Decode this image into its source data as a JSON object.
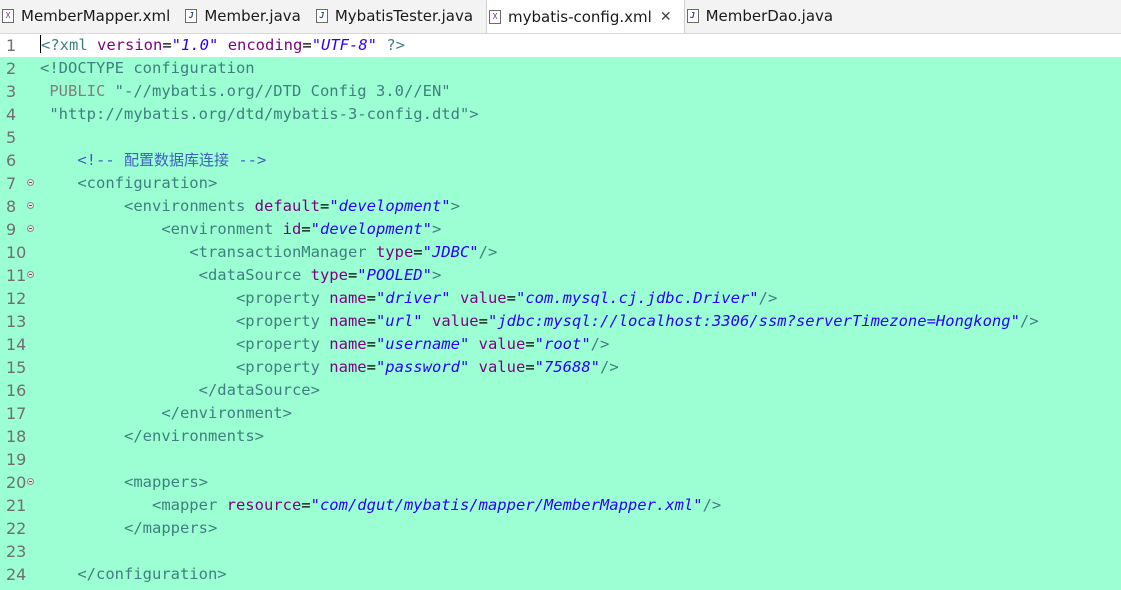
{
  "tabs": [
    {
      "label": "MemberMapper.xml",
      "icon": "xml-file-icon",
      "glyph": "X",
      "kind": "xml",
      "active": false,
      "closable": false
    },
    {
      "label": "Member.java",
      "icon": "java-file-icon",
      "glyph": "J",
      "kind": "java",
      "active": false,
      "closable": false
    },
    {
      "label": "MybatisTester.java",
      "icon": "java-file-icon",
      "glyph": "J",
      "kind": "java",
      "active": false,
      "closable": false
    },
    {
      "label": "mybatis-config.xml",
      "icon": "xml-file-icon",
      "glyph": "X",
      "kind": "xml",
      "active": true,
      "closable": true
    },
    {
      "label": "MemberDao.java",
      "icon": "java-file-icon",
      "glyph": "J",
      "kind": "java",
      "active": false,
      "closable": false
    }
  ],
  "close_glyph": "✕",
  "editor": {
    "background": "#9cffd4",
    "current_line_background": "#ffffff",
    "lines": [
      {
        "n": "1",
        "fold": false,
        "current": true,
        "caret": true,
        "indent": "",
        "tokens": [
          {
            "t": "<?xml ",
            "c": "t-pi"
          },
          {
            "t": "version",
            "c": "t-attr"
          },
          {
            "t": "=",
            "c": "t-plain"
          },
          {
            "t": "\"1.0\"",
            "c": "t-str"
          },
          {
            "t": " ",
            "c": "t-plain"
          },
          {
            "t": "encoding",
            "c": "t-attr"
          },
          {
            "t": "=",
            "c": "t-plain"
          },
          {
            "t": "\"UTF-8\"",
            "c": "t-str"
          },
          {
            "t": " ?>",
            "c": "t-pi"
          }
        ]
      },
      {
        "n": "2",
        "fold": false,
        "indent": "",
        "tokens": [
          {
            "t": "<!DOCTYPE ",
            "c": "t-doc"
          },
          {
            "t": "configuration",
            "c": "t-doc"
          }
        ]
      },
      {
        "n": "3",
        "fold": false,
        "indent": " ",
        "tokens": [
          {
            "t": "PUBLIC ",
            "c": "t-pub"
          },
          {
            "t": "\"-//mybatis.org//DTD Config 3.0//EN\"",
            "c": "t-docstr"
          }
        ]
      },
      {
        "n": "4",
        "fold": false,
        "indent": " ",
        "tokens": [
          {
            "t": "\"http://mybatis.org/dtd/mybatis-3-config.dtd\"",
            "c": "t-docstr"
          },
          {
            "t": ">",
            "c": "t-doc"
          }
        ]
      },
      {
        "n": "5",
        "fold": false,
        "indent": "",
        "tokens": []
      },
      {
        "n": "6",
        "fold": false,
        "indent": "    ",
        "tokens": [
          {
            "t": "<!-- ",
            "c": "t-cmt"
          },
          {
            "t": "配置数据库连接",
            "c": "t-cmt t-cn"
          },
          {
            "t": " -->",
            "c": "t-cmt"
          }
        ]
      },
      {
        "n": "7",
        "fold": true,
        "indent": "    ",
        "tokens": [
          {
            "t": "<configuration>",
            "c": "t-tag"
          }
        ]
      },
      {
        "n": "8",
        "fold": true,
        "indent": "         ",
        "tokens": [
          {
            "t": "<environments ",
            "c": "t-tag"
          },
          {
            "t": "default",
            "c": "t-attr"
          },
          {
            "t": "=",
            "c": "t-plain"
          },
          {
            "t": "\"development\"",
            "c": "t-str"
          },
          {
            "t": ">",
            "c": "t-tag"
          }
        ]
      },
      {
        "n": "9",
        "fold": true,
        "indent": "             ",
        "tokens": [
          {
            "t": "<environment ",
            "c": "t-tag"
          },
          {
            "t": "id",
            "c": "t-attr"
          },
          {
            "t": "=",
            "c": "t-plain"
          },
          {
            "t": "\"development\"",
            "c": "t-str"
          },
          {
            "t": ">",
            "c": "t-tag"
          }
        ]
      },
      {
        "n": "10",
        "fold": false,
        "indent": "                ",
        "tokens": [
          {
            "t": "<transactionManager ",
            "c": "t-tag"
          },
          {
            "t": "type",
            "c": "t-attr"
          },
          {
            "t": "=",
            "c": "t-plain"
          },
          {
            "t": "\"JDBC\"",
            "c": "t-str"
          },
          {
            "t": "/>",
            "c": "t-tag"
          }
        ]
      },
      {
        "n": "11",
        "fold": true,
        "indent": "                 ",
        "tokens": [
          {
            "t": "<dataSource ",
            "c": "t-tag"
          },
          {
            "t": "type",
            "c": "t-attr"
          },
          {
            "t": "=",
            "c": "t-plain"
          },
          {
            "t": "\"POOLED\"",
            "c": "t-str"
          },
          {
            "t": ">",
            "c": "t-tag"
          }
        ]
      },
      {
        "n": "12",
        "fold": false,
        "indent": "                     ",
        "tokens": [
          {
            "t": "<property ",
            "c": "t-tag"
          },
          {
            "t": "name",
            "c": "t-attr"
          },
          {
            "t": "=",
            "c": "t-plain"
          },
          {
            "t": "\"driver\"",
            "c": "t-str"
          },
          {
            "t": " ",
            "c": "t-plain"
          },
          {
            "t": "value",
            "c": "t-attr"
          },
          {
            "t": "=",
            "c": "t-plain"
          },
          {
            "t": "\"com.mysql.cj.jdbc.Driver\"",
            "c": "t-str"
          },
          {
            "t": "/>",
            "c": "t-tag"
          }
        ]
      },
      {
        "n": "13",
        "fold": false,
        "indent": "                     ",
        "tokens": [
          {
            "t": "<property ",
            "c": "t-tag"
          },
          {
            "t": "name",
            "c": "t-attr"
          },
          {
            "t": "=",
            "c": "t-plain"
          },
          {
            "t": "\"url\"",
            "c": "t-str"
          },
          {
            "t": " ",
            "c": "t-plain"
          },
          {
            "t": "value",
            "c": "t-attr"
          },
          {
            "t": "=",
            "c": "t-plain"
          },
          {
            "t": "\"jdbc:mysql://localhost:3306/ssm?serverTimezone=Hongkong\"",
            "c": "t-str"
          },
          {
            "t": "/>",
            "c": "t-tag"
          }
        ]
      },
      {
        "n": "14",
        "fold": false,
        "indent": "                     ",
        "tokens": [
          {
            "t": "<property ",
            "c": "t-tag"
          },
          {
            "t": "name",
            "c": "t-attr"
          },
          {
            "t": "=",
            "c": "t-plain"
          },
          {
            "t": "\"username\"",
            "c": "t-str"
          },
          {
            "t": " ",
            "c": "t-plain"
          },
          {
            "t": "value",
            "c": "t-attr"
          },
          {
            "t": "=",
            "c": "t-plain"
          },
          {
            "t": "\"root\"",
            "c": "t-str"
          },
          {
            "t": "/>",
            "c": "t-tag"
          }
        ]
      },
      {
        "n": "15",
        "fold": false,
        "indent": "                     ",
        "tokens": [
          {
            "t": "<property ",
            "c": "t-tag"
          },
          {
            "t": "name",
            "c": "t-attr"
          },
          {
            "t": "=",
            "c": "t-plain"
          },
          {
            "t": "\"password\"",
            "c": "t-str"
          },
          {
            "t": " ",
            "c": "t-plain"
          },
          {
            "t": "value",
            "c": "t-attr"
          },
          {
            "t": "=",
            "c": "t-plain"
          },
          {
            "t": "\"75688\"",
            "c": "t-str"
          },
          {
            "t": "/>",
            "c": "t-tag"
          }
        ]
      },
      {
        "n": "16",
        "fold": false,
        "indent": "                 ",
        "tokens": [
          {
            "t": "</dataSource>",
            "c": "t-tag"
          }
        ]
      },
      {
        "n": "17",
        "fold": false,
        "indent": "             ",
        "tokens": [
          {
            "t": "</environment>",
            "c": "t-tag"
          }
        ]
      },
      {
        "n": "18",
        "fold": false,
        "indent": "         ",
        "tokens": [
          {
            "t": "</environments>",
            "c": "t-tag"
          }
        ]
      },
      {
        "n": "19",
        "fold": false,
        "indent": "",
        "tokens": []
      },
      {
        "n": "20",
        "fold": true,
        "indent": "         ",
        "tokens": [
          {
            "t": "<mappers>",
            "c": "t-tag"
          }
        ]
      },
      {
        "n": "21",
        "fold": false,
        "indent": "            ",
        "tokens": [
          {
            "t": "<mapper ",
            "c": "t-tag"
          },
          {
            "t": "resource",
            "c": "t-attr"
          },
          {
            "t": "=",
            "c": "t-plain"
          },
          {
            "t": "\"com/dgut/mybatis/mapper/MemberMapper.xml\"",
            "c": "t-str"
          },
          {
            "t": "/>",
            "c": "t-tag"
          }
        ]
      },
      {
        "n": "22",
        "fold": false,
        "indent": "         ",
        "tokens": [
          {
            "t": "</mappers>",
            "c": "t-tag"
          }
        ]
      },
      {
        "n": "23",
        "fold": false,
        "indent": "",
        "tokens": []
      },
      {
        "n": "24",
        "fold": false,
        "indent": "    ",
        "tokens": [
          {
            "t": "</configuration>",
            "c": "t-tag"
          }
        ]
      }
    ]
  }
}
